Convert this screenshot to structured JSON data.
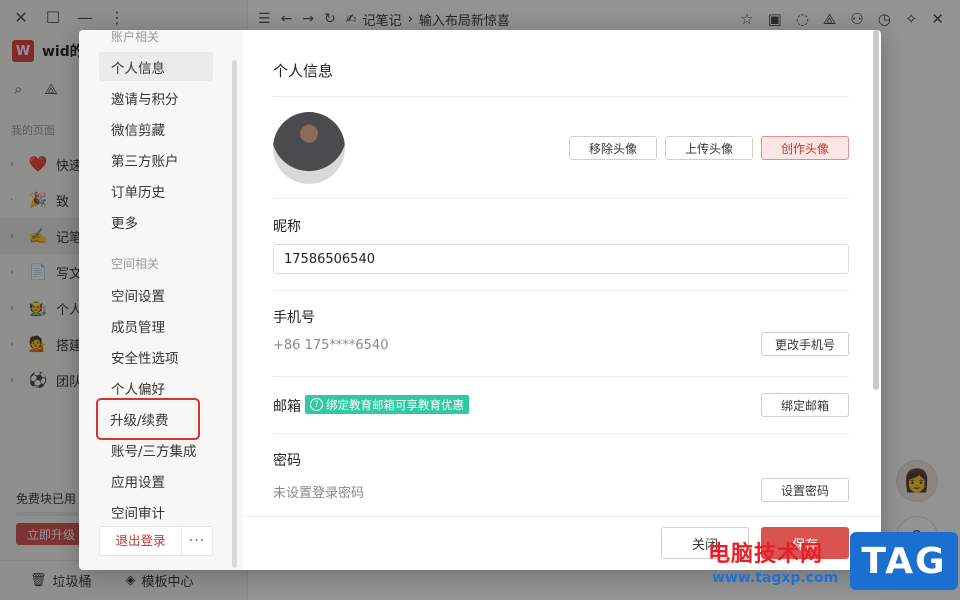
{
  "app": {
    "workspace_initial": "W",
    "workspace_name": "wid的",
    "section_label": "我的页面",
    "breadcrumb": [
      "记笔记",
      "输入布局新惊喜"
    ],
    "pages": [
      {
        "icon": "heart",
        "emoji": "❤️",
        "label": "快速"
      },
      {
        "icon": "party",
        "emoji": "🎉",
        "label": "致"
      },
      {
        "icon": "pen",
        "emoji": "✍️",
        "label": "记笔"
      },
      {
        "icon": "doc",
        "emoji": "📄",
        "label": "写文"
      },
      {
        "icon": "person",
        "emoji": "🧑‍🌾",
        "label": "个人"
      },
      {
        "icon": "person2",
        "emoji": "💁",
        "label": "搭建"
      },
      {
        "icon": "ball",
        "emoji": "⚽",
        "label": "团队"
      }
    ],
    "free_blocks_label": "免费块已用",
    "upgrade_label": "立即升级",
    "trash_label": "垃圾桶",
    "templates_label": "模板中心"
  },
  "modal": {
    "nav": {
      "account_header": "账户相关",
      "account_items": [
        "个人信息",
        "邀请与积分",
        "微信剪藏",
        "第三方账户",
        "订单历史",
        "更多"
      ],
      "space_header": "空间相关",
      "space_items": [
        "空间设置",
        "成员管理",
        "安全性选项",
        "个人偏好",
        "升级/续费",
        "账号/三方集成",
        "应用设置",
        "空间审计"
      ],
      "logout_label": "退出登录",
      "more_label": "···"
    },
    "content": {
      "title": "个人信息",
      "remove_avatar": "移除头像",
      "upload_avatar": "上传头像",
      "create_avatar": "创作头像",
      "nickname_label": "昵称",
      "nickname_value": "17586506540",
      "phone_label": "手机号",
      "phone_value": "+86 175****6540",
      "change_phone": "更改手机号",
      "email_label": "邮箱",
      "edu_badge": "绑定教育邮箱可享教育优惠",
      "bind_email": "绑定邮箱",
      "password_label": "密码",
      "password_value": "未设置登录密码",
      "set_password": "设置密码"
    },
    "footer": {
      "close_label": "关闭",
      "save_label": "保存"
    }
  },
  "watermark": {
    "text": "电脑技术网",
    "url": "www.tagxp.com",
    "tag": "TAG"
  }
}
